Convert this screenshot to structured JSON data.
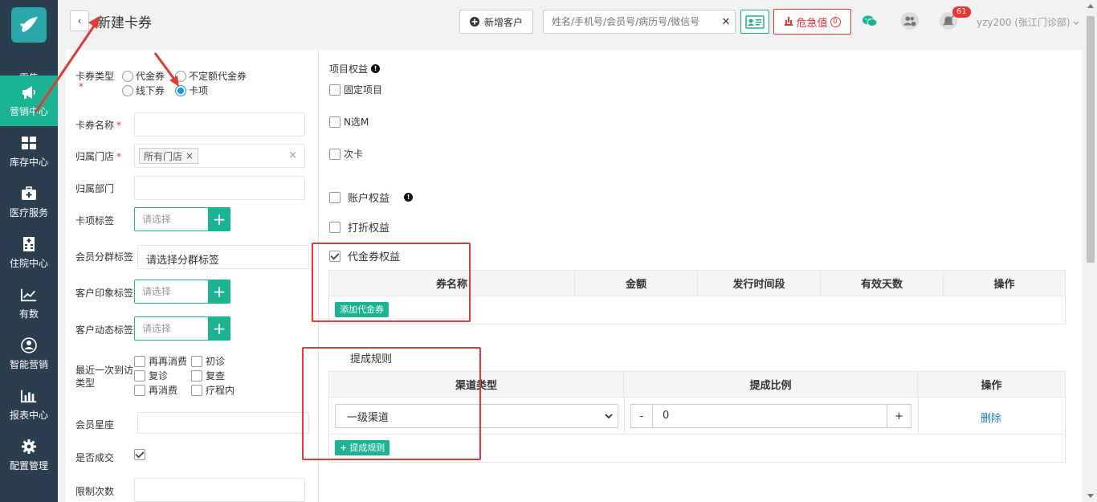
{
  "sidebar": {
    "items": [
      {
        "label": "零售",
        "icon": "retail-icon"
      },
      {
        "label": "营销中心",
        "icon": "megaphone-icon",
        "active": true
      },
      {
        "label": "库存中心",
        "icon": "grid-icon"
      },
      {
        "label": "医疗服务",
        "icon": "medical-kit-icon"
      },
      {
        "label": "住院中心",
        "icon": "hospital-icon"
      },
      {
        "label": "有数",
        "icon": "trend-line-icon"
      },
      {
        "label": "智能营销",
        "icon": "smart-marketing-icon"
      },
      {
        "label": "报表中心",
        "icon": "bar-chart-icon"
      },
      {
        "label": "配置管理",
        "icon": "gear-icon"
      }
    ]
  },
  "header": {
    "back": "‹",
    "title": "新建卡券",
    "new_customer": "新增客户",
    "search_placeholder": "姓名/手机号/会员号/病历号/微信号",
    "search_clear": "✕",
    "danger_label": "危急值",
    "danger_count": "0",
    "notifications": "61",
    "user": "yzy200 (张江门诊部)"
  },
  "form": {
    "coupon_type_label": "卡券类型",
    "coupon_type_req": "*",
    "coupon_types": [
      "代金券",
      "不定额代金券",
      "线下券",
      "卡项"
    ],
    "coupon_type_selected": "卡项",
    "name_label": "卡券名称",
    "name_req": "*",
    "store_label": "归属门店",
    "store_req": "*",
    "store_tag": "所有门店",
    "tag_remove": "×",
    "clear": "×",
    "dept_label": "归属部门",
    "card_tag_label": "卡项标签",
    "card_tag_placeholder": "请选择",
    "member_group_label": "会员分群标签",
    "member_group_placeholder": "请选择分群标签",
    "impression_label": "客户印象标签",
    "impression_placeholder": "请选择",
    "dynamic_label": "客户动态标签",
    "dynamic_placeholder": "请选择",
    "last_visit_label_1": "最近一次到访",
    "last_visit_label_2": "类型",
    "visit_types": [
      "再再消费",
      "初诊",
      "复诊",
      "复查",
      "再消费",
      "疗程内"
    ],
    "constellation_label": "会员星座",
    "deal_label": "是否成交",
    "limit_label": "限制次数"
  },
  "rights": {
    "project_rights": "项目权益",
    "info_icon": "!",
    "fixed_project": "固定项目",
    "n_choose_m": "N选M",
    "times_card": "次卡",
    "account_rights": "账户权益",
    "discount_rights": "打折权益",
    "voucher_rights": "代金券权益",
    "voucher_cols": [
      "券名称",
      "金额",
      "发行时间段",
      "有效天数",
      "操作"
    ],
    "add_voucher": "添加代金券",
    "commission_title": "提成规则",
    "commission_cols": [
      "渠道类型",
      "提成比例",
      "操作"
    ],
    "channel_value": "一级渠道",
    "minus": "-",
    "ratio_value": "0",
    "plus": "+",
    "delete": "删除",
    "add_rule": "提成规则",
    "add_rule_icon": "+"
  }
}
